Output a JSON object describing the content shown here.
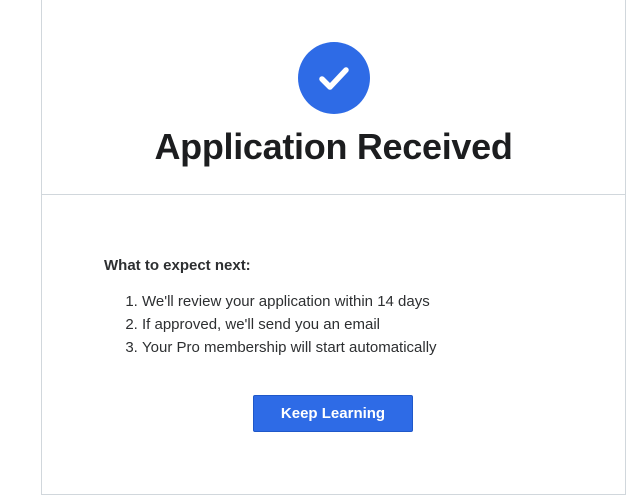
{
  "header": {
    "icon": "checkmark-icon",
    "title": "Application Received"
  },
  "content": {
    "heading": "What to expect next:",
    "steps": [
      "We'll review your application within 14 days",
      "If approved, we'll send you an email",
      "Your Pro membership will start automatically"
    ]
  },
  "actions": {
    "primary_label": "Keep Learning"
  },
  "colors": {
    "accent": "#2e6be6",
    "text": "#1c1d1f",
    "border": "#d1d7dc"
  }
}
